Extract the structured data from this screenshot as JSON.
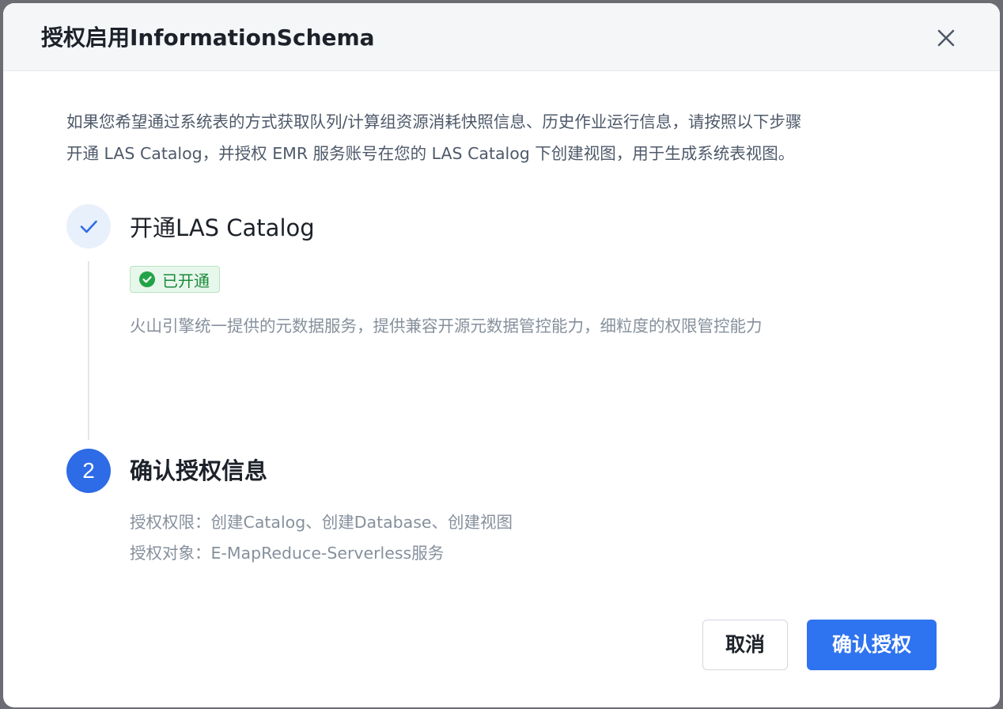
{
  "dialog": {
    "title": "授权启用InformationSchema",
    "close_icon": "close-icon"
  },
  "intro": {
    "line1": "如果您希望通过系统表的方式获取队列/计算组资源消耗快照信息、历史作业运行信息，请按照以下步骤",
    "line2": "开通 LAS Catalog，并授权 EMR 服务账号在您的 LAS Catalog 下创建视图，用于生成系统表视图。"
  },
  "steps": [
    {
      "icon": "check-icon",
      "title": "开通LAS Catalog",
      "badge": "已开通",
      "badge_icon": "check-circle-icon",
      "description": "火山引擎统一提供的元数据服务，提供兼容开源元数据管控能力，细粒度的权限管控能力"
    },
    {
      "number": "2",
      "title": "确认授权信息",
      "permission_line": "授权权限：创建Catalog、创建Database、创建视图",
      "target_line": "授权对象：E-MapReduce-Serverless服务"
    }
  ],
  "footer": {
    "cancel_label": "取消",
    "confirm_label": "确认授权"
  },
  "colors": {
    "primary": "#2e73f0",
    "success": "#1a8a3a",
    "success_bg": "#e8f7ec",
    "text_primary": "#1d2129",
    "text_secondary": "#86909c"
  }
}
